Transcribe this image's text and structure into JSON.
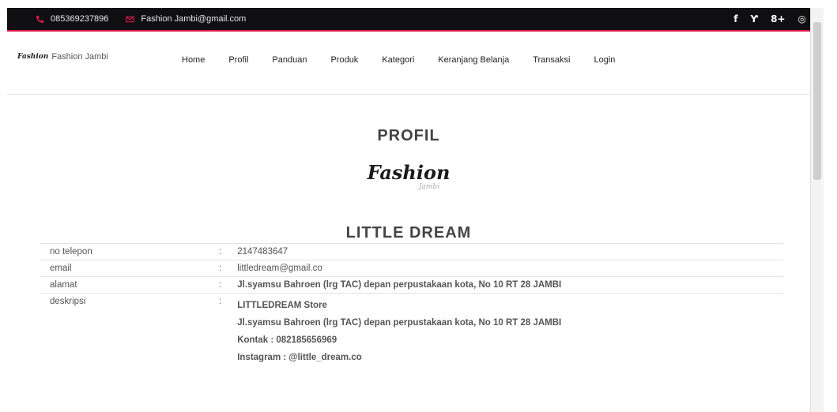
{
  "topbar": {
    "phone": "085369237896",
    "email": "Fashion Jambi@gmail.com",
    "social": [
      "f",
      "Ƴ",
      "8+",
      "◎"
    ],
    "accent": "#e0194c",
    "background": "#0f0f12"
  },
  "brand": {
    "logo_text": "Fashion",
    "name": "Fashion Jambi"
  },
  "menu": {
    "items": [
      "Home",
      "Profil",
      "Panduan",
      "Produk",
      "Kategori",
      "Keranjang Belanja",
      "Transaksi",
      "Login"
    ]
  },
  "page": {
    "title": "PROFIL",
    "logo_line1": "Fashion",
    "logo_line2": "Jambi",
    "store_name": "LITTLE DREAM"
  },
  "info": {
    "separator": ":",
    "rows": [
      {
        "label": "no telepon",
        "value": "2147483647"
      },
      {
        "label": "email",
        "value": "littledream@gmail.co"
      },
      {
        "label": "alamat",
        "value": "Jl.syamsu Bahroen (lrg TAC) depan perpustakaan kota, No 10 RT 28 JAMBI"
      },
      {
        "label": "deskripsi",
        "lines": [
          "LITTLEDREAM Store",
          "Jl.syamsu Bahroen (lrg TAC) depan perpustakaan kota, No 10 RT 28 JAMBI",
          "Kontak : 082185656969",
          "Instagram : @little_dream.co"
        ]
      }
    ]
  }
}
